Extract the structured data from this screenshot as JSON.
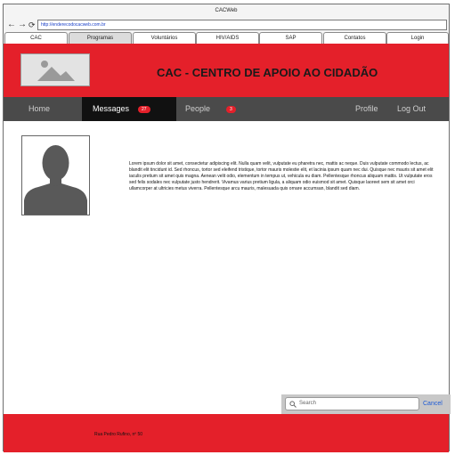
{
  "browser": {
    "title": "CACWeb",
    "back_glyph": "←",
    "forward_glyph": "→",
    "reload_glyph": "⟳",
    "url": "http://enderecodocacweb.com.br"
  },
  "tabs": [
    {
      "label": "CAC",
      "active": false
    },
    {
      "label": "Programas",
      "active": true
    },
    {
      "label": "Voluntários",
      "active": false
    },
    {
      "label": "HIV/AIDS",
      "active": false
    },
    {
      "label": "SAP",
      "active": false
    },
    {
      "label": "Contatos",
      "active": false
    },
    {
      "label": "Login",
      "active": false
    }
  ],
  "header": {
    "title": "CAC - CENTRO DE APOIO AO CIDADÃO",
    "logo_icon": "image-placeholder-icon",
    "color": "#e4202a"
  },
  "menu": {
    "home": "Home",
    "messages": "Messages",
    "messages_count": "27",
    "people": "People",
    "people_count": "3",
    "profile": "Profile",
    "logout": "Log Out"
  },
  "content": {
    "avatar_icon": "person-avatar-icon",
    "body": "Lorem ipsum dolor sit amet, consectetur adipiscing elit. Nulla quam velit, vulputate eu pharetra nec, mattis ac neque. Duis vulputate commodo lectus, ac blandit elit tincidunt id. Sed rhoncus, tortor sed eleifend tristique, tortor mauris molestie elit, et lacinia ipsum quam nec dui. Quisque nec mauris sit amet elit iaculis pretium sit amet quis magna. Aenean velit odio, elementum in tempus ut, vehicula eu diam. Pellentesque rhoncus aliquam mattis. Ut vulputate eros sed felis sodales nec vulputate justo hendrerit. Vivamus varius pretium ligula, a aliquam odio euismod sit amet. Quisque laoreet sem sit amet orci ullamcorper at ultricies metus viverra. Pellentesque arcu mauris, malesuada quis ornare accumsan, blandit sed diam."
  },
  "search": {
    "placeholder": "Search",
    "cancel": "Cancel"
  },
  "footer": {
    "address": "Rua Pedro Rufino, nº 50"
  }
}
